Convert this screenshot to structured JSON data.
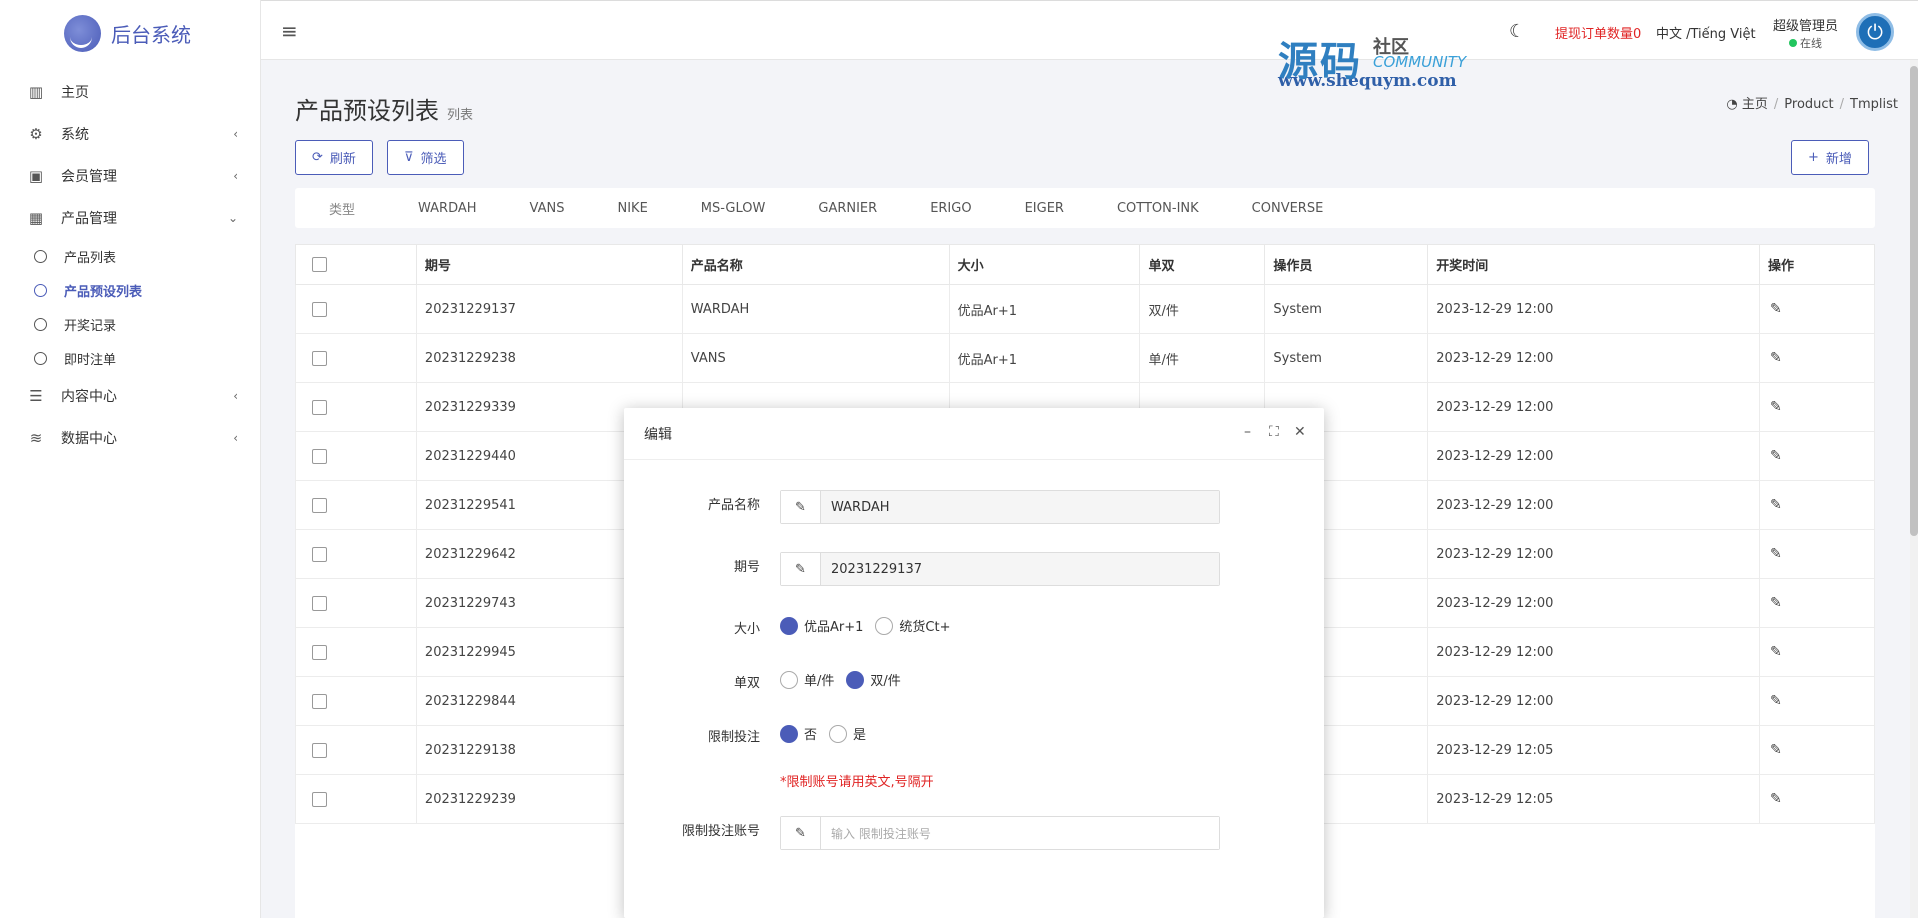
{
  "brand": {
    "name": "后台系统"
  },
  "sidebar": {
    "items": [
      {
        "label": "主页",
        "icon": "bar-chart-icon",
        "glyph": "▥"
      },
      {
        "label": "系统",
        "icon": "gear-icon",
        "glyph": "⚙",
        "chevron": "‹"
      },
      {
        "label": "会员管理",
        "icon": "id-card-icon",
        "glyph": "▣",
        "chevron": "‹"
      },
      {
        "label": "产品管理",
        "icon": "grid-icon",
        "glyph": "▦",
        "chevron": "⌄"
      }
    ],
    "sub_items": [
      {
        "label": "产品列表"
      },
      {
        "label": "产品预设列表"
      },
      {
        "label": "开奖记录"
      },
      {
        "label": "即时注单"
      }
    ],
    "items_after": [
      {
        "label": "内容中心",
        "icon": "comments-icon",
        "glyph": "☰",
        "chevron": "‹"
      },
      {
        "label": "数据中心",
        "icon": "database-icon",
        "glyph": "≋",
        "chevron": "‹"
      }
    ]
  },
  "header": {
    "watermark_big": "源码",
    "watermark_cn": "社区",
    "watermark_en": "COMMUNITY",
    "watermark_url": "www.shequym.com",
    "orders_label": "提现订单数量0",
    "lang_label": "中文 /Tiếng Việt",
    "user_name": "超级管理员",
    "user_status": "在线"
  },
  "page": {
    "title": "产品预设列表",
    "subtitle": "列表",
    "breadcrumb": [
      "主页",
      "Product",
      "Tmplist"
    ]
  },
  "toolbar": {
    "refresh": "刷新",
    "filter": "筛选",
    "add": "新增"
  },
  "filter": {
    "label": "类型",
    "options": [
      "WARDAH",
      "VANS",
      "NIKE",
      "MS-GLOW",
      "GARNIER",
      "ERIGO",
      "EIGER",
      "COTTON-INK",
      "CONVERSE"
    ]
  },
  "table": {
    "headers": [
      "期号",
      "产品名称",
      "大小",
      "单双",
      "操作员",
      "开奖时间",
      "操作"
    ],
    "rows": [
      {
        "issue": "20231229137",
        "product": "WARDAH",
        "size": "优品Ar+1",
        "parity": "双/件",
        "operator": "System",
        "time": "2023-12-29 12:00"
      },
      {
        "issue": "20231229238",
        "product": "VANS",
        "size": "优品Ar+1",
        "parity": "单/件",
        "operator": "System",
        "time": "2023-12-29 12:00"
      },
      {
        "issue": "20231229339",
        "product": "",
        "size": "",
        "parity": "",
        "operator": "",
        "time": "2023-12-29 12:00"
      },
      {
        "issue": "20231229440",
        "product": "",
        "size": "",
        "parity": "",
        "operator": "",
        "time": "2023-12-29 12:00"
      },
      {
        "issue": "20231229541",
        "product": "",
        "size": "",
        "parity": "",
        "operator": "",
        "time": "2023-12-29 12:00"
      },
      {
        "issue": "20231229642",
        "product": "",
        "size": "",
        "parity": "",
        "operator": "",
        "time": "2023-12-29 12:00"
      },
      {
        "issue": "20231229743",
        "product": "",
        "size": "",
        "parity": "",
        "operator": "",
        "time": "2023-12-29 12:00"
      },
      {
        "issue": "20231229945",
        "product": "",
        "size": "",
        "parity": "",
        "operator": "",
        "time": "2023-12-29 12:00"
      },
      {
        "issue": "20231229844",
        "product": "",
        "size": "",
        "parity": "",
        "operator": "",
        "time": "2023-12-29 12:00"
      },
      {
        "issue": "20231229138",
        "product": "",
        "size": "",
        "parity": "",
        "operator": "",
        "time": "2023-12-29 12:05"
      },
      {
        "issue": "20231229239",
        "product": "",
        "size": "",
        "parity": "",
        "operator": "",
        "time": "2023-12-29 12:05"
      }
    ]
  },
  "modal": {
    "title": "编辑",
    "product_label": "产品名称",
    "product_value": "WARDAH",
    "issue_label": "期号",
    "issue_value": "20231229137",
    "size_label": "大小",
    "size_options": [
      "优品Ar+1",
      "统货Ct+"
    ],
    "size_selected": 0,
    "parity_label": "单双",
    "parity_options": [
      "单/件",
      "双/件"
    ],
    "parity_selected": 1,
    "limit_label": "限制投注",
    "limit_options": [
      "否",
      "是"
    ],
    "limit_selected": 0,
    "hint": "*限制账号请用英文,号隔开",
    "accounts_label": "限制投注账号",
    "accounts_placeholder": "输入 限制投注账号"
  },
  "colors": {
    "accent": "#4b5cb8",
    "danger": "#e02424",
    "online": "#22c55e"
  }
}
